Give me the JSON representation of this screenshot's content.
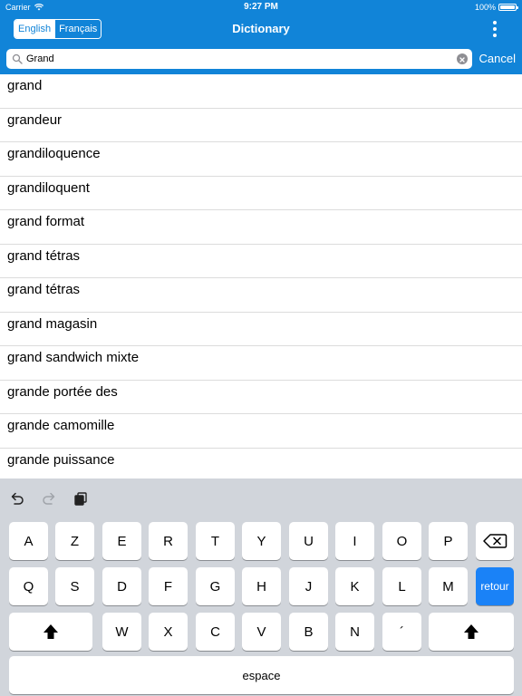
{
  "status_bar": {
    "carrier": "Carrier",
    "time": "9:27 PM",
    "battery": "100%",
    "battery_level": 1.0
  },
  "nav": {
    "languages": [
      "English",
      "Français"
    ],
    "active_language": "Français",
    "title": "Dictionary",
    "menu_icon": "more-vertical-icon"
  },
  "search": {
    "value": "Grand",
    "cancel_label": "Cancel"
  },
  "results": [
    "grand",
    "grandeur",
    "grandiloquence",
    "grandiloquent",
    "grand format",
    "grand tétras",
    "grand tétras",
    "grand magasin",
    "grand sandwich mixte",
    "grande portée des",
    "grande camomille",
    "grande puissance"
  ],
  "keyboard": {
    "toolbar": [
      "undo-icon",
      "redo-icon",
      "clipboard-icon"
    ],
    "row1": [
      "A",
      "Z",
      "E",
      "R",
      "T",
      "Y",
      "U",
      "I",
      "O",
      "P"
    ],
    "row2": [
      "Q",
      "S",
      "D",
      "F",
      "G",
      "H",
      "J",
      "K",
      "L",
      "M"
    ],
    "row3": [
      "W",
      "X",
      "C",
      "V",
      "B",
      "N",
      "´"
    ],
    "return_label": "retour",
    "space_label": "espace"
  },
  "colors": {
    "accent": "#1184d8",
    "return_key": "#1a82f7",
    "keyboard_bg": "#d1d5db"
  }
}
